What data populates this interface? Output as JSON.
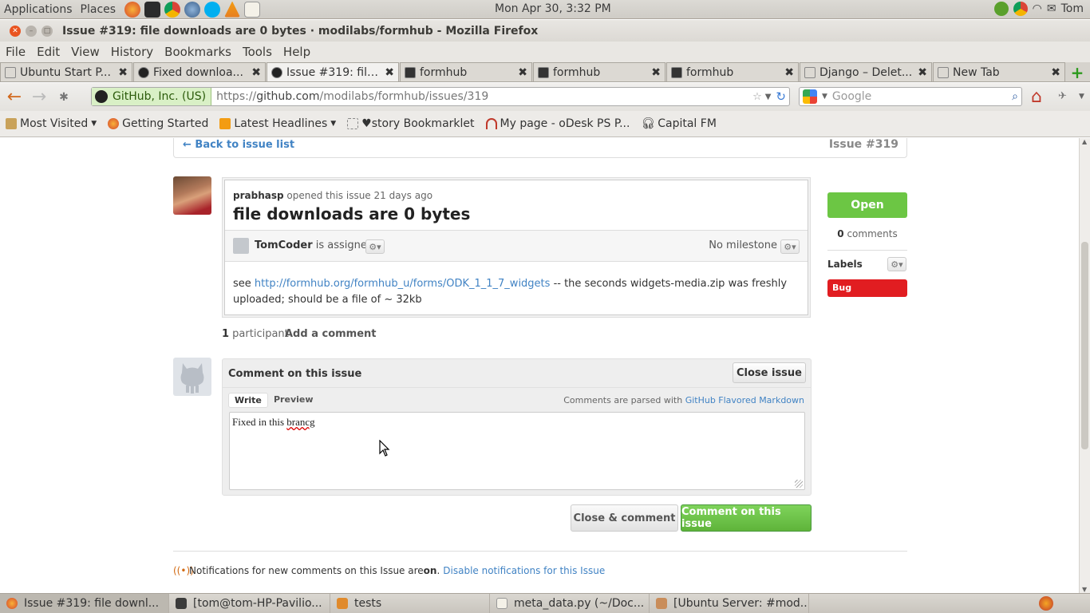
{
  "desktop": {
    "menus": [
      "Applications",
      "Places"
    ],
    "clock": "Mon Apr 30,  3:32 PM",
    "user": "Tom"
  },
  "window": {
    "title": "Issue #319: file downloads are 0 bytes · modilabs/formhub - Mozilla Firefox"
  },
  "menu_bar": [
    "File",
    "Edit",
    "View",
    "History",
    "Bookmarks",
    "Tools",
    "Help"
  ],
  "tabs": [
    {
      "label": "Ubuntu Start P..."
    },
    {
      "label": "Fixed downloa..."
    },
    {
      "label": "Issue #319: file..."
    },
    {
      "label": "formhub"
    },
    {
      "label": "formhub"
    },
    {
      "label": "formhub"
    },
    {
      "label": "Django – Delet..."
    },
    {
      "label": "New Tab"
    }
  ],
  "nav": {
    "identity": "GitHub, Inc. (US)",
    "url_prefix": "https://",
    "url_host": "github.com",
    "url_path": "/modilabs/formhub/issues/319",
    "search_placeholder": "Google"
  },
  "bookmarks": [
    "Most Visited",
    "Getting Started",
    "Latest Headlines",
    "♥story Bookmarklet",
    "My page - oDesk PS P...",
    "Capital FM"
  ],
  "issue": {
    "back_link": "← Back to issue list",
    "number": "Issue #319",
    "author": "prabhasp",
    "opened_text": " opened this issue 21 days ago",
    "title": "file downloads are 0 bytes",
    "assignee": "TomCoder",
    "assigned_text": " is assigned",
    "milestone": "No milestone",
    "body_prefix": "see ",
    "body_link": "http://formhub.org/formhub_u/forms/ODK_1_1_7_widgets",
    "body_suffix": " -- the seconds widgets-media.zip was freshly uploaded; should be a file of ~ 32kb",
    "participants_count": "1",
    "participants_label": " participant",
    "add_comment": "Add a comment"
  },
  "sidebar": {
    "state": "Open",
    "comments_count": "0",
    "comments_label": " comments",
    "labels_title": "Labels",
    "labels": [
      {
        "name": "Bug",
        "color": "#e11d21"
      }
    ]
  },
  "comment_form": {
    "title": "Comment on this issue",
    "close_issue": "Close issue",
    "tab_write": "Write",
    "tab_preview": "Preview",
    "markdown_prefix": "Comments are parsed with ",
    "markdown_link": "GitHub Flavored Markdown",
    "text_prefix": "Fixed in this ",
    "text_misspelled": "brancg",
    "close_and_comment": "Close & comment",
    "submit": "Comment on this issue"
  },
  "notifications": {
    "prefix": "Notifications for new comments on this Issue are ",
    "state": "on",
    "suffix": ".",
    "link": "Disable notifications for this Issue"
  },
  "taskbar": [
    {
      "label": "Issue #319: file downl..."
    },
    {
      "label": "[tom@tom-HP-Pavilio..."
    },
    {
      "label": "tests"
    },
    {
      "label": "meta_data.py (~/Doc..."
    },
    {
      "label": "[Ubuntu Server: #mod..."
    }
  ],
  "colors": {
    "accent_green": "#6cc644",
    "link_blue": "#4183c4",
    "bug_red": "#e11d21",
    "ubuntu_orange": "#e95420"
  }
}
